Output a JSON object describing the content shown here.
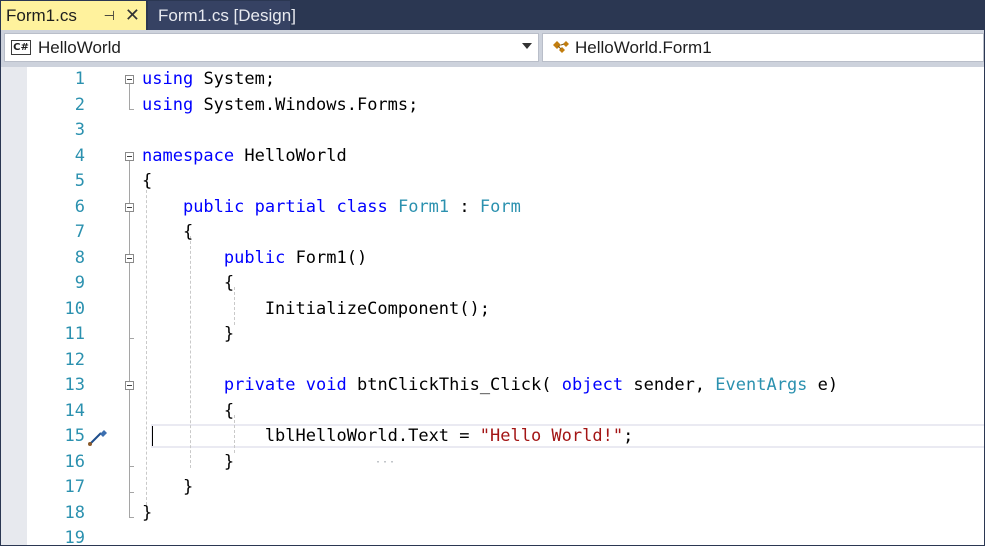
{
  "tabs": [
    {
      "label": "Form1.cs",
      "active": true,
      "pin_icon": "pin-icon",
      "close_icon": "close-icon"
    },
    {
      "label": "Form1.cs [Design]",
      "active": false
    }
  ],
  "navbar": {
    "project_badge": "C#",
    "project": "HelloWorld",
    "member": "HelloWorld.Form1"
  },
  "editor": {
    "line_numbers": [
      "1",
      "2",
      "3",
      "4",
      "5",
      "6",
      "7",
      "8",
      "9",
      "10",
      "11",
      "12",
      "13",
      "14",
      "15",
      "16",
      "17",
      "18",
      "19"
    ],
    "current_line": "15",
    "lines": [
      [
        [
          "kw",
          "using"
        ],
        [
          "",
          "System;"
        ]
      ],
      [
        [
          "kw",
          "using"
        ],
        [
          "",
          "System.Windows.Forms;"
        ]
      ],
      [],
      [
        [
          "kw",
          "namespace"
        ],
        [
          "",
          "HelloWorld"
        ]
      ],
      [
        [
          "",
          "{"
        ]
      ],
      [
        [
          "",
          "    "
        ],
        [
          "kw",
          "public"
        ],
        [
          "kw",
          "partial"
        ],
        [
          "kw",
          "class"
        ],
        [
          "ty",
          "Form1"
        ],
        [
          "",
          ":"
        ],
        [
          "ty",
          "Form"
        ]
      ],
      [
        [
          "",
          "    {"
        ]
      ],
      [
        [
          "",
          "        "
        ],
        [
          "kw",
          "public"
        ],
        [
          "",
          "Form1()"
        ]
      ],
      [
        [
          "",
          "        {"
        ]
      ],
      [
        [
          "",
          "            InitializeComponent();"
        ]
      ],
      [
        [
          "",
          "        }"
        ]
      ],
      [],
      [
        [
          "",
          "        "
        ],
        [
          "kw",
          "private"
        ],
        [
          "kw",
          "void"
        ],
        [
          "",
          "btnClickThis_Click("
        ],
        [
          "kw",
          "object"
        ],
        [
          "",
          "sender,"
        ],
        [
          "ty",
          "EventArgs"
        ],
        [
          "",
          "e)"
        ]
      ],
      [
        [
          "",
          "        {"
        ]
      ],
      [
        [
          "",
          "            lblHelloWorld.Text ="
        ],
        [
          "str",
          "\"Hello World!\""
        ],
        [
          "",
          ";"
        ]
      ],
      [
        [
          "",
          "        }"
        ]
      ],
      [
        [
          "",
          "    }"
        ]
      ],
      [
        [
          "",
          "}"
        ]
      ],
      []
    ]
  },
  "colors": {
    "keyword": "#0000ff",
    "type": "#2b91af",
    "string": "#a31515",
    "line_number": "#2b91af",
    "active_tab": "#fff29d",
    "chrome": "#2b3752"
  }
}
